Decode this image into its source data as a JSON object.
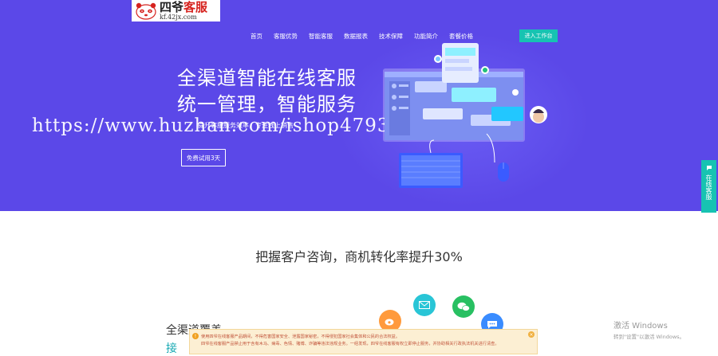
{
  "logo": {
    "title_a": "四爷",
    "title_b": "客服",
    "url": "kf.42jx.com"
  },
  "nav": {
    "items": [
      "首页",
      "客服优势",
      "智能客服",
      "数据报表",
      "技术保障",
      "功能简介",
      "套餐价格"
    ],
    "cta": "进入工作台"
  },
  "hero": {
    "headline_1": "全渠道智能在线客服",
    "headline_2": "统一管理，智能服务",
    "subtitle": "提升客服服务效率，专注线上销售",
    "trial_button": "免费试用3天",
    "watermark": "https://www.huzhan.com/ishop47934"
  },
  "side_float": {
    "label": "在线客服"
  },
  "section": {
    "title": "把握客户咨询，商机转化率提升30%",
    "partial_heading_1": "全渠道覆盖",
    "partial_heading_2": "接"
  },
  "notice": {
    "line_1": "使用四爷在线客服产品期间，不得危害国家安全、泄露国家秘密，不得侵犯国家社会集体和公民的合法权益。",
    "line_2": "四爷在线客服产品禁止用于含有木马、病毒、色情、赌博、诈骗等违法违规业务。一经发现，四爷在线客服有权立即停止服务，并协助相关行政执法机关进行清查。"
  },
  "windows_activation": {
    "title": "激活 Windows",
    "hint": "转到\"设置\"以激活 Windows。"
  },
  "colors": {
    "hero_bg": "#5b48e8",
    "accent": "#17c3b2",
    "notice_bg": "#fcefd3"
  },
  "icons": [
    "panda-logo-icon",
    "monitor-illustration",
    "keyboard-illustration",
    "mouse-illustration",
    "mail-icon",
    "wechat-icon",
    "weibo-icon",
    "chat-icon",
    "close-icon",
    "warning-icon"
  ]
}
